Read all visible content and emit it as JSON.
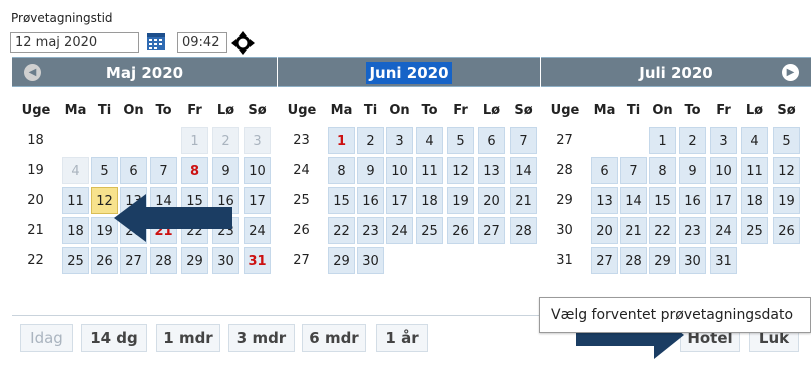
{
  "field": {
    "label": "Prøvetagningstid",
    "date_value": "12 maj 2020",
    "time_value": "09:42"
  },
  "weekday_headers": [
    "Uge",
    "Ma",
    "Ti",
    "On",
    "To",
    "Fr",
    "Lø",
    "Sø"
  ],
  "months": [
    {
      "title": "Maj  2020",
      "selected": false,
      "weeks": [
        {
          "wk": "18",
          "days": [
            null,
            null,
            null,
            null,
            {
              "d": "1",
              "out": true
            },
            {
              "d": "2",
              "out": true
            },
            {
              "d": "3",
              "out": true
            }
          ]
        },
        {
          "wk": "19",
          "days": [
            null,
            {
              "d": "4",
              "out": true
            },
            {
              "d": "5"
            },
            {
              "d": "6"
            },
            {
              "d": "7"
            },
            {
              "d": "8",
              "red": true
            },
            {
              "d": "9"
            },
            {
              "d": "10"
            }
          ]
        },
        {
          "wk": "20",
          "days": [
            {
              "d": "11"
            },
            {
              "d": "12",
              "today": true
            },
            {
              "d": "13"
            },
            {
              "d": "14"
            },
            {
              "d": "15"
            },
            {
              "d": "16"
            },
            {
              "d": "17"
            }
          ]
        },
        {
          "wk": "21",
          "days": [
            {
              "d": "18"
            },
            {
              "d": "19"
            },
            {
              "d": "20"
            },
            {
              "d": "21",
              "red": true
            },
            {
              "d": "22"
            },
            {
              "d": "23"
            },
            {
              "d": "24"
            }
          ]
        },
        {
          "wk": "22",
          "days": [
            {
              "d": "25"
            },
            {
              "d": "26"
            },
            {
              "d": "27"
            },
            {
              "d": "28"
            },
            {
              "d": "29"
            },
            {
              "d": "30"
            },
            {
              "d": "31",
              "red": true
            }
          ]
        }
      ]
    },
    {
      "title": "Juni  2020",
      "selected": true,
      "weeks": [
        {
          "wk": "23",
          "days": [
            {
              "d": "1",
              "red": true
            },
            {
              "d": "2"
            },
            {
              "d": "3"
            },
            {
              "d": "4"
            },
            {
              "d": "5"
            },
            {
              "d": "6"
            },
            {
              "d": "7"
            }
          ]
        },
        {
          "wk": "24",
          "days": [
            {
              "d": "8"
            },
            {
              "d": "9"
            },
            {
              "d": "10"
            },
            {
              "d": "11"
            },
            {
              "d": "12"
            },
            {
              "d": "13"
            },
            {
              "d": "14"
            }
          ]
        },
        {
          "wk": "25",
          "days": [
            {
              "d": "15"
            },
            {
              "d": "16"
            },
            {
              "d": "17"
            },
            {
              "d": "18"
            },
            {
              "d": "19"
            },
            {
              "d": "20"
            },
            {
              "d": "21"
            }
          ]
        },
        {
          "wk": "26",
          "days": [
            {
              "d": "22"
            },
            {
              "d": "23"
            },
            {
              "d": "24"
            },
            {
              "d": "25"
            },
            {
              "d": "26"
            },
            {
              "d": "27"
            },
            {
              "d": "28"
            }
          ]
        },
        {
          "wk": "27",
          "days": [
            {
              "d": "29"
            },
            {
              "d": "30"
            },
            null,
            null,
            null,
            null,
            null
          ]
        }
      ]
    },
    {
      "title": "Juli  2020",
      "selected": false,
      "weeks": [
        {
          "wk": "27",
          "days": [
            null,
            null,
            {
              "d": "1"
            },
            {
              "d": "2"
            },
            {
              "d": "3"
            },
            {
              "d": "4"
            },
            {
              "d": "5"
            }
          ]
        },
        {
          "wk": "28",
          "days": [
            {
              "d": "6"
            },
            {
              "d": "7"
            },
            {
              "d": "8"
            },
            {
              "d": "9"
            },
            {
              "d": "10"
            },
            {
              "d": "11"
            },
            {
              "d": "12"
            }
          ]
        },
        {
          "wk": "29",
          "days": [
            {
              "d": "13"
            },
            {
              "d": "14"
            },
            {
              "d": "15"
            },
            {
              "d": "16"
            },
            {
              "d": "17"
            },
            {
              "d": "18"
            },
            {
              "d": "19"
            }
          ]
        },
        {
          "wk": "30",
          "days": [
            {
              "d": "20"
            },
            {
              "d": "21"
            },
            {
              "d": "22"
            },
            {
              "d": "23"
            },
            {
              "d": "24"
            },
            {
              "d": "25"
            },
            {
              "d": "26"
            }
          ]
        },
        {
          "wk": "31",
          "days": [
            {
              "d": "27"
            },
            {
              "d": "28"
            },
            {
              "d": "29"
            },
            {
              "d": "30"
            },
            {
              "d": "31"
            },
            null,
            null
          ]
        }
      ]
    }
  ],
  "footer_buttons": [
    {
      "label": "Idag",
      "disabled": true
    },
    {
      "label": "14 dg"
    },
    {
      "label": "1 mdr"
    },
    {
      "label": "3 mdr"
    },
    {
      "label": "6 mdr"
    },
    {
      "label": "1 år"
    }
  ],
  "hotel_label": "Hotel",
  "close_label": "Luk",
  "tooltip": "Vælg forventet prøvetagningsdato",
  "colors": {
    "header_bg": "#6b7d8b",
    "day_bg": "#dde9f4",
    "today_bg": "#f7e28d",
    "holiday_text": "#cc1111",
    "arrow": "#1b3d63"
  }
}
